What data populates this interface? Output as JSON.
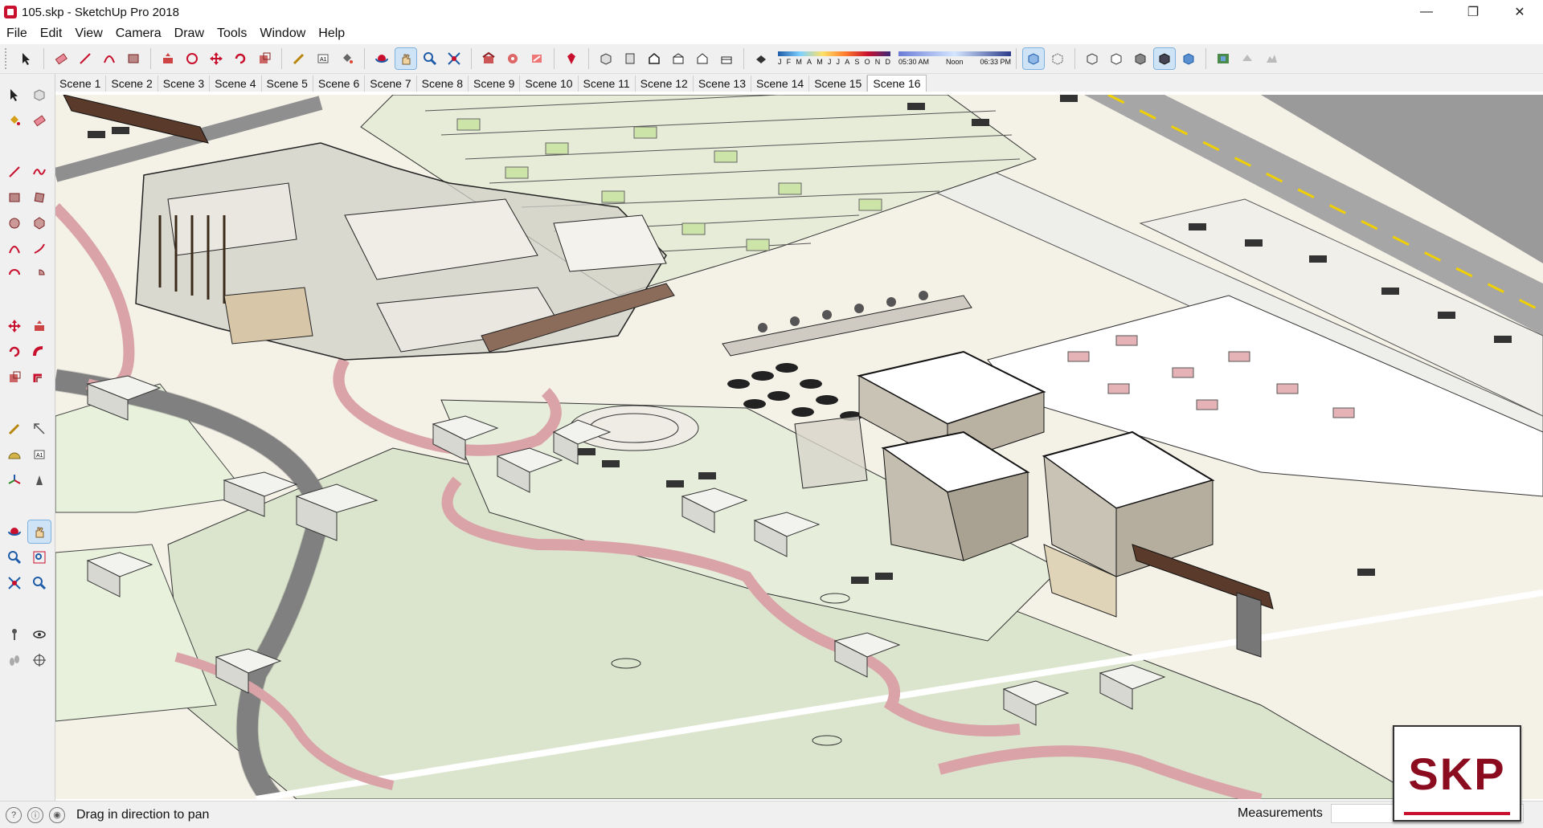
{
  "window": {
    "title": "105.skp - SketchUp Pro 2018",
    "minimize": "—",
    "maximize": "❐",
    "close": "✕"
  },
  "menu": [
    "File",
    "Edit",
    "View",
    "Camera",
    "Draw",
    "Tools",
    "Window",
    "Help"
  ],
  "toolbar": {
    "shadow_months": [
      "J",
      "F",
      "M",
      "A",
      "M",
      "J",
      "J",
      "A",
      "S",
      "O",
      "N",
      "D"
    ],
    "time_start": "05:30 AM",
    "time_noon": "Noon",
    "time_end": "06:33 PM"
  },
  "scenes": [
    "Scene 1",
    "Scene 2",
    "Scene 3",
    "Scene 4",
    "Scene 5",
    "Scene 6",
    "Scene 7",
    "Scene 8",
    "Scene 9",
    "Scene 10",
    "Scene 11",
    "Scene 12",
    "Scene 13",
    "Scene 14",
    "Scene 15",
    "Scene 16"
  ],
  "active_scene": "Scene 16",
  "status": {
    "hint": "Drag in direction to pan",
    "measurements_label": "Measurements",
    "measurements_value": ""
  },
  "watermark": "SKP",
  "colors": {
    "accent": "#c8102e",
    "ground": "#e8f1dc",
    "road": "#8f8f8f",
    "path": "#d9a3a8"
  }
}
